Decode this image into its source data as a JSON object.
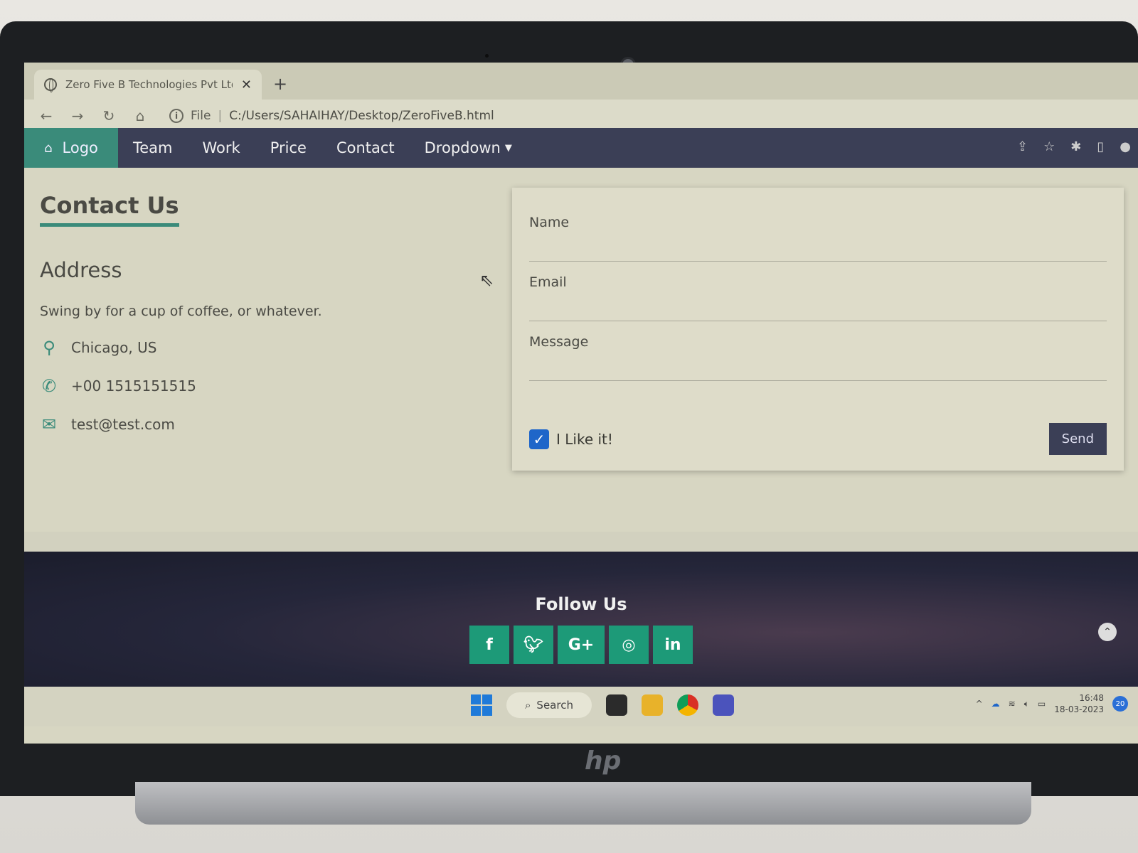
{
  "browser": {
    "tab_title": "Zero Five B Technologies Pvt Ltd",
    "tab_close": "✕",
    "new_tab": "+",
    "omnibox_scheme": "File",
    "omnibox_url": "C:/Users/SAHAIHAY/Desktop/ZeroFiveB.html"
  },
  "site_nav": {
    "logo_label": "Logo",
    "items": [
      {
        "label": "Team"
      },
      {
        "label": "Work"
      },
      {
        "label": "Price"
      },
      {
        "label": "Contact"
      },
      {
        "label": "Dropdown"
      }
    ]
  },
  "contact": {
    "title": "Contact Us",
    "address_heading": "Address",
    "intro": "Swing by for a cup of coffee, or whatever.",
    "location": "Chicago, US",
    "phone": "+00 1515151515",
    "email": "test@test.com"
  },
  "form": {
    "name_label": "Name",
    "email_label": "Email",
    "message_label": "Message",
    "checkbox_label": "I Like it!",
    "checkbox_checked": true,
    "send_label": "Send"
  },
  "footer": {
    "follow_label": "Follow Us",
    "social": [
      "f",
      "t",
      "G+",
      "ig",
      "in"
    ]
  },
  "taskbar": {
    "search_label": "Search",
    "time": "16:48",
    "date": "18-03-2023",
    "notifications": "20"
  },
  "colors": {
    "nav_bg": "#3b3f56",
    "accent": "#3a8b7a",
    "social_bg": "#1d9a78",
    "checkbox": "#1f66c9"
  }
}
